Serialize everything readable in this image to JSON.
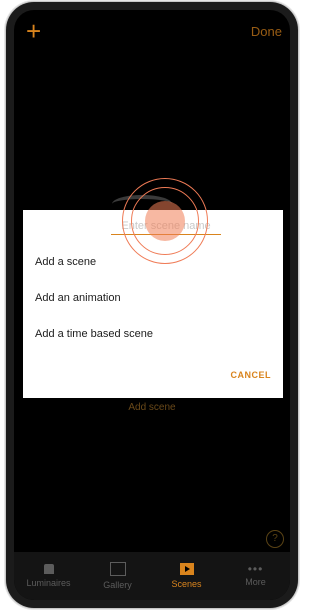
{
  "topbar": {
    "add_label": "+",
    "done_label": "Done"
  },
  "background": {
    "add_scene_label": "Add scene",
    "help_label": "?"
  },
  "dialog": {
    "placeholder": "Enter scene name",
    "options": [
      "Add a scene",
      "Add an animation",
      "Add a time based scene"
    ],
    "cancel_label": "CANCEL"
  },
  "tabs": [
    {
      "label": "Luminaires",
      "icon": "lamp-icon"
    },
    {
      "label": "Gallery",
      "icon": "gallery-icon"
    },
    {
      "label": "Scenes",
      "icon": "scenes-icon",
      "active": true
    },
    {
      "label": "More",
      "icon": "more-icon"
    }
  ],
  "colors": {
    "accent": "#d9841d",
    "touch": "#ef7b56",
    "background": "#000000"
  }
}
